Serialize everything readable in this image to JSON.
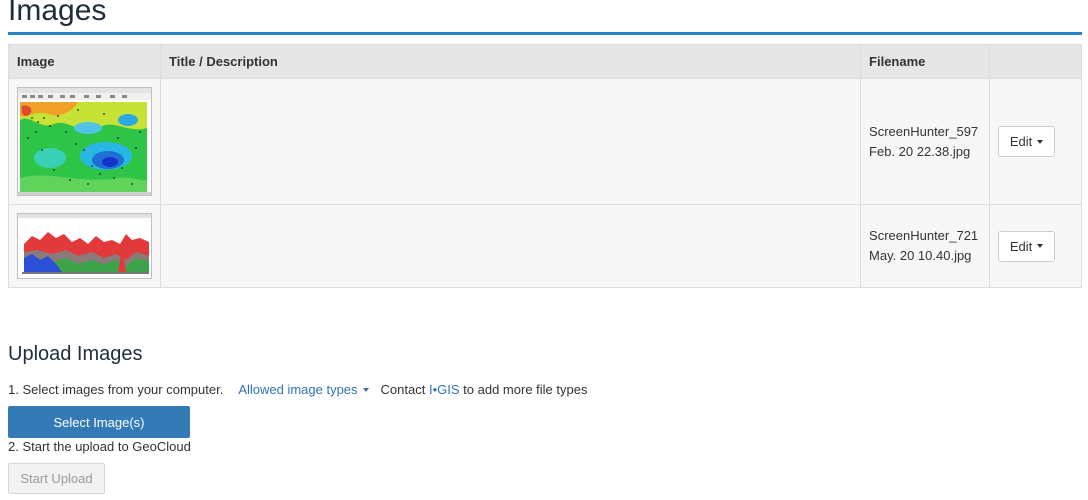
{
  "page": {
    "title": "Images"
  },
  "table": {
    "headers": {
      "image": "Image",
      "title": "Title / Description",
      "filename": "Filename",
      "action": ""
    },
    "rows": [
      {
        "thumbnail_icon": "map-screenshot-thumbnail",
        "title": "",
        "filename_line1": "ScreenHunter_597",
        "filename_line2": "Feb. 20 22.38.jpg",
        "edit_label": "Edit"
      },
      {
        "thumbnail_icon": "profile-chart-screenshot-thumbnail",
        "title": "",
        "filename_line1": "ScreenHunter_721",
        "filename_line2": "May. 20 10.40.jpg",
        "edit_label": "Edit"
      }
    ]
  },
  "upload": {
    "title": "Upload Images",
    "step1": "1. Select images from your computer.",
    "allowed_types_label": "Allowed image types",
    "contact_prefix": "Contact",
    "contact_brand": "I•GIS",
    "contact_suffix": "to add more file types",
    "select_button": "Select Image(s)",
    "step2": "2. Start the upload to GeoCloud",
    "start_button": "Start Upload"
  },
  "colors": {
    "accent": "#2a82c9",
    "primary_button": "#337ab7",
    "link": "#3173b8"
  }
}
